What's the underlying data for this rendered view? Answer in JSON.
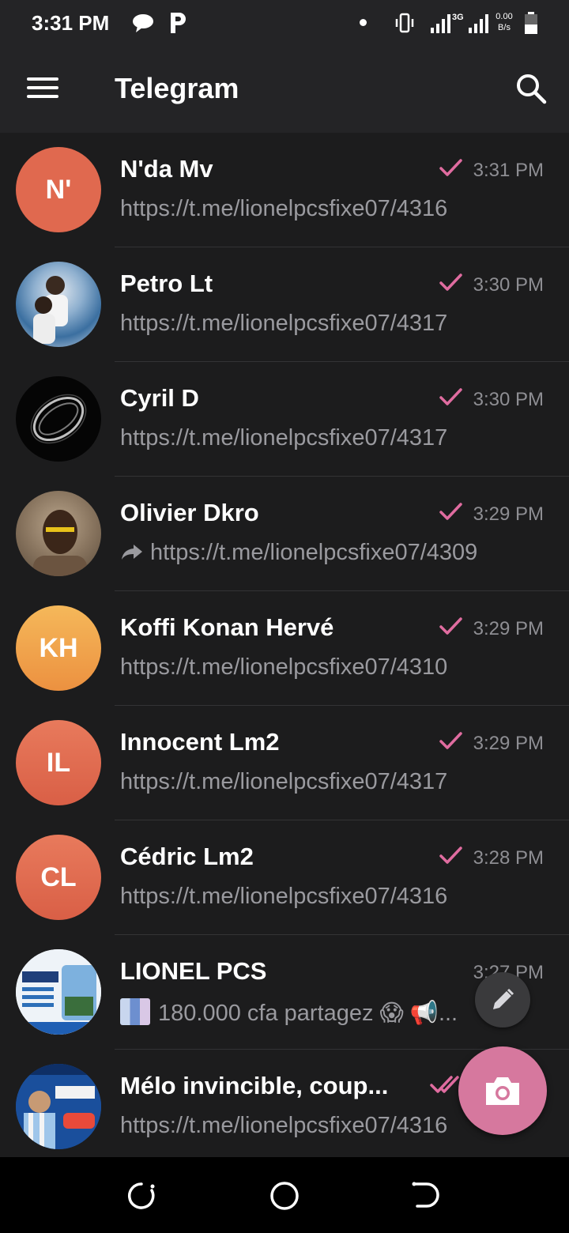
{
  "status_bar": {
    "time": "3:31 PM",
    "network_type": "3G",
    "data_speed": "0.00",
    "data_unit": "B/s",
    "icons": [
      "chat-bubble-icon",
      "p-notification-icon",
      "dot-icon",
      "vibrate-icon",
      "signal-icon",
      "signal-icon",
      "battery-icon"
    ]
  },
  "header": {
    "title": "Telegram",
    "menu_icon": "hamburger-menu-icon",
    "search_icon": "search-icon"
  },
  "colors": {
    "background": "#1c1c1d",
    "header": "#242426",
    "accent_check": "#e06ca0",
    "fab_camera": "#d6789e"
  },
  "chats": [
    {
      "name": "N'da Mv",
      "initials": "N'",
      "time": "3:31 PM",
      "preview": "https://t.me/lionelpcsfixe07/4316",
      "status": "read-single-check",
      "avatar_color": "#e0694f"
    },
    {
      "name": "Petro Lt",
      "initials": "",
      "time": "3:30 PM",
      "preview": "https://t.me/lionelpcsfixe07/4317",
      "status": "read-single-check",
      "avatar_color": "#3b6fa0"
    },
    {
      "name": "Cyril D",
      "initials": "",
      "time": "3:30 PM",
      "preview": "https://t.me/lionelpcsfixe07/4317",
      "status": "read-single-check",
      "avatar_color": "#050505"
    },
    {
      "name": "Olivier Dkro",
      "initials": "",
      "time": "3:29 PM",
      "preview": "https://t.me/lionelpcsfixe07/4309",
      "status": "read-single-check",
      "avatar_color": "#7a6a5a",
      "forwarded": true
    },
    {
      "name": "Koffi Konan Hervé",
      "initials": "KH",
      "time": "3:29 PM",
      "preview": "https://t.me/lionelpcsfixe07/4310",
      "status": "read-single-check",
      "avatar_color": "#f0a04b"
    },
    {
      "name": "Innocent Lm2",
      "initials": "IL",
      "time": "3:29 PM",
      "preview": "https://t.me/lionelpcsfixe07/4317",
      "status": "read-single-check",
      "avatar_color": "#e0694f"
    },
    {
      "name": "Cédric Lm2",
      "initials": "CL",
      "time": "3:28 PM",
      "preview": "https://t.me/lionelpcsfixe07/4316",
      "status": "read-single-check",
      "avatar_color": "#e0694f"
    },
    {
      "name": "LIONEL PCS",
      "initials": "",
      "time": "3:27 PM",
      "preview": "180.000 cfa partagez 😱  📢...",
      "status": "none",
      "avatar_color": "#e8eef5"
    },
    {
      "name": "Mélo invincible, coup...",
      "initials": "",
      "time": "",
      "preview": "https://t.me/lionelpcsfixe07/4316",
      "status": "read-double-check",
      "avatar_color": "#1a4f9c"
    }
  ],
  "fab": {
    "edit_icon": "pencil-icon",
    "camera_icon": "camera-icon"
  },
  "nav": {
    "icons": [
      "recent-apps-icon",
      "home-icon",
      "back-icon"
    ]
  }
}
